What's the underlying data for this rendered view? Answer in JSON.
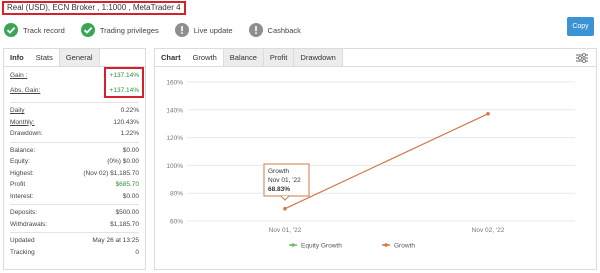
{
  "account": {
    "title": "Real (USD), ECN Broker , 1:1000 , MetaTrader 4"
  },
  "badges": [
    {
      "label": "Track record",
      "icon": "check-icon",
      "status": "ok"
    },
    {
      "label": "Trading privileges",
      "icon": "check-icon",
      "status": "ok"
    },
    {
      "label": "Live update",
      "icon": "exclamation-icon",
      "status": "no"
    },
    {
      "label": "Cashback",
      "icon": "exclamation-icon",
      "status": "no"
    }
  ],
  "copy_button": {
    "label": "Copy"
  },
  "left_tabs": [
    {
      "label": "Info"
    },
    {
      "label": "Stats"
    },
    {
      "label": "General"
    }
  ],
  "stats": {
    "gain": {
      "label": "Gain :",
      "value": "+137.14%"
    },
    "abs_gain": {
      "label": "Abs. Gain:",
      "value": "+137.14%"
    },
    "daily": {
      "label": "Daily",
      "value": "0.22%"
    },
    "monthly": {
      "label": "Monthly:",
      "value": "120.43%"
    },
    "drawdown": {
      "label": "Drawdown:",
      "value": "1.22%"
    },
    "balance": {
      "label": "Balance:",
      "value": "$0.00"
    },
    "equity": {
      "label": "Equity:",
      "value": "(0%) $0.00"
    },
    "highest": {
      "label": "Highest:",
      "value": "(Nov 02) $1,185.70"
    },
    "profit": {
      "label": "Profit",
      "value": "$685.70"
    },
    "interest": {
      "label": "Interest:",
      "value": "$0.00"
    },
    "deposits": {
      "label": "Deposits:",
      "value": "$500.00"
    },
    "withdrawals": {
      "label": "Withdrawals:",
      "value": "$1,185.70"
    },
    "updated": {
      "label": "Updated",
      "value": "May 26 at 13:25"
    },
    "tracking": {
      "label": "Tracking",
      "value": "0"
    }
  },
  "right_tabs": [
    {
      "label": "Chart"
    },
    {
      "label": "Growth"
    },
    {
      "label": "Balance"
    },
    {
      "label": "Profit"
    },
    {
      "label": "Drawdown"
    }
  ],
  "colors": {
    "growth": "#d2784a",
    "equity_growth": "#6fbf5f",
    "gain_green": "#2e8f3a",
    "highlight_red": "#d6212a",
    "copy_blue": "#3b93d6"
  },
  "chart_data": {
    "type": "line",
    "categories": [
      "Nov 01, '22",
      "Nov 02, '22"
    ],
    "y_ticks": [
      "60%",
      "80%",
      "100%",
      "120%",
      "140%",
      "160%"
    ],
    "ylim": [
      60,
      160
    ],
    "grid": true,
    "legend_position": "bottom",
    "series": [
      {
        "name": "Equity Growth",
        "values": []
      },
      {
        "name": "Growth",
        "values": [
          68.83,
          137.14
        ]
      }
    ],
    "tooltip": {
      "title": "Growth",
      "date": "Nov 01, '22",
      "value": "68.83%"
    }
  }
}
